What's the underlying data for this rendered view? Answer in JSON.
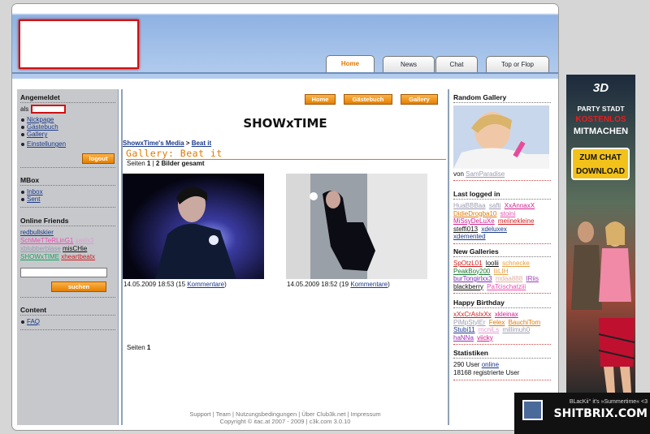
{
  "header": {
    "tabs": [
      {
        "label": "Home"
      },
      {
        "label": "News"
      },
      {
        "label": "Chat"
      },
      {
        "label": "Top or Flop"
      }
    ]
  },
  "sidebar": {
    "login": {
      "title": "Angemeldet",
      "as_label": "als",
      "links": [
        "Nickpage",
        "Gästebuch",
        "Gallery",
        "Einstellungen"
      ],
      "logout": "logout"
    },
    "mbox": {
      "title": "MBox",
      "links": [
        "Inbox",
        "Sent"
      ]
    },
    "friends": {
      "title": "Online Friends",
      "names": [
        "redbullskier",
        "SchMeTTeRLinG1",
        "saslx3",
        "xblubberblase",
        "misCHie",
        "SHOWxTIME",
        "xheartbeatx"
      ],
      "search_button": "suchen"
    },
    "content": {
      "title": "Content",
      "links": [
        "FAQ"
      ]
    }
  },
  "main": {
    "nav_buttons": [
      "Home",
      "Gästebuch",
      "Gallery"
    ],
    "title": "SHOWxTIME",
    "breadcrumb": {
      "part1": "ShowxTime's Media",
      "sep": ">",
      "part2": "Beat it"
    },
    "gallery_heading": "Gallery: Beat it",
    "pages_top": {
      "label": "Seiten",
      "page": "1",
      "sep": "|",
      "total": "2 Bilder gesamt"
    },
    "photos": [
      {
        "date": "14.05.2009 18:53",
        "open": "(15",
        "link": "Kommentare",
        "close": ")"
      },
      {
        "date": "14.05.2009 18:52",
        "open": "(19",
        "link": "Kommentare",
        "close": ")"
      }
    ],
    "pages_bottom": {
      "label": "Seiten",
      "page": "1"
    },
    "footer": {
      "links": [
        "Support",
        "Team",
        "Nutzungsbedingungen",
        "Über Club3k.net",
        "Impressum"
      ],
      "copyright": "Copyright © itac.at 2007 - 2009 | c3k.com 3.0.10"
    }
  },
  "right": {
    "random": {
      "title": "Random Gallery",
      "by_label": "von",
      "by_user": "SamParadise"
    },
    "logged": {
      "title": "Last logged in",
      "names": [
        "HuaBBBaa",
        "safti",
        "XxAnnaxX",
        "DidieDrogba10",
        "stoini",
        "MiSsyDeLuXe",
        "meiinekleine",
        "steffi013",
        "xdeluxex",
        "xdemented"
      ]
    },
    "newgal": {
      "title": "New Galleries",
      "names": [
        "SpOtzL01",
        "loolii",
        "schnecke",
        "PeakBoy200",
        "liiLIH",
        "burTongirlxx3",
        "mdaa888",
        "IRiis",
        "blackberry",
        "PaTcischatziii"
      ]
    },
    "bday": {
      "title": "Happy Birthday",
      "names": [
        "xXxCrAsIxXx",
        "xkleinax",
        "PiMpStylEr",
        "Felex",
        "BauchiTom",
        "Stubi11",
        "mcniLs",
        "millimuh0",
        "haNNa",
        "viicky"
      ]
    },
    "stats": {
      "title": "Statistiken",
      "line1_num": "290 User",
      "line1_link": "online",
      "line2": "18168 registrierte User"
    }
  },
  "ads": {
    "right": {
      "top": "3D",
      "l1": "PARTY STADT",
      "l2": "KOSTENLOS",
      "l3": "MITMACHEN",
      "btn1": "ZUM CHAT",
      "btn2": "DOWNLOAD"
    },
    "bottom": {
      "small": "BLacKii° it's »Summertime« <3",
      "brand": "SHITBRIX.COM"
    }
  },
  "colors": {
    "accent": "#e07a00",
    "link": "#1a3a8a",
    "header_blue": "#8fb2e3"
  }
}
